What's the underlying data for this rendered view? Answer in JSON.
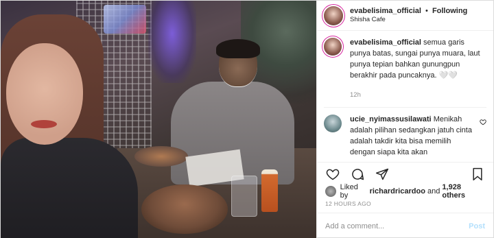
{
  "header": {
    "username": "evabelisima_official",
    "separator": "•",
    "follow_status": "Following",
    "location": "Shisha Cafe"
  },
  "caption": {
    "username": "evabelisima_official",
    "text": "semua garis punya batas, sungai punya muara, laut punya tepian bahkan gunungpun berakhir pada puncaknya. 🤍🤍",
    "time": "12h"
  },
  "comment": {
    "username": "ucie_nyimassusilawati",
    "text": "Menikah adalah pilihan sedangkan jatuh cinta adalah takdir kita bisa memilih dengan siapa kita akan"
  },
  "actions": {
    "like_icon": "heart-icon",
    "comment_icon": "comment-icon",
    "share_icon": "share-icon",
    "save_icon": "bookmark-icon"
  },
  "likes": {
    "prefix": "Liked by",
    "user": "richardricardoo",
    "middle": "and",
    "others": "1,928 others"
  },
  "timestamp": "12 HOURS AGO",
  "add_comment": {
    "placeholder": "Add a comment...",
    "post_label": "Post"
  },
  "colors": {
    "text": "#262626",
    "muted": "#8e8e8e",
    "post_disabled": "#b2dffc",
    "border": "#efefef"
  }
}
